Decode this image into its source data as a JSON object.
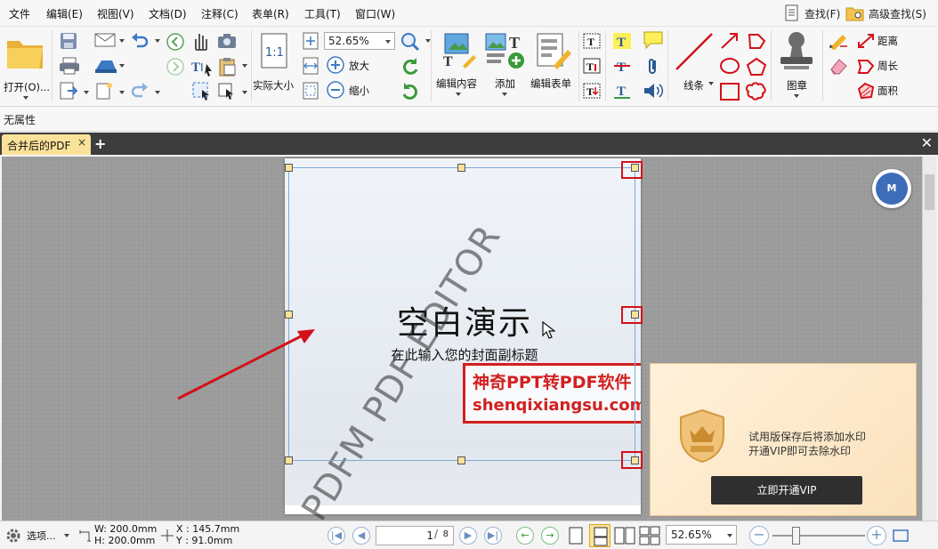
{
  "menu": [
    "文件",
    "编辑(E)",
    "视图(V)",
    "文档(D)",
    "注释(C)",
    "表单(R)",
    "工具(T)",
    "窗口(W)"
  ],
  "search": {
    "find_label": "查找(F)",
    "advanced_label": "高级查找(S)"
  },
  "ribbon": {
    "open_label": "打开(O)...",
    "zoom_value": "52.65%",
    "actual_size_label": "实际大小",
    "zoom_in_label": "放大",
    "zoom_out_label": "缩小",
    "edit_content_label": "编辑内容",
    "add_label": "添加",
    "edit_form_label": "编辑表单",
    "lines_label": "线条",
    "stamp_label": "图章",
    "distance_label": "距离",
    "perimeter_label": "周长",
    "area_label": "面积"
  },
  "properties": {
    "label": "无属性"
  },
  "tabs": [
    {
      "label": "合并后的PDF"
    }
  ],
  "slide": {
    "title": "空白演示",
    "subtitle": "在此输入您的封面副标题",
    "watermark": "PDFM PDF EDITOR",
    "stamp_line1": "神奇PPT转PDF软件",
    "stamp_line2": "shenqixiangsu.com"
  },
  "vip": {
    "line1": "试用版保存后将添加水印",
    "line2": "开通VIP即可去除水印",
    "button": "立即开通VIP"
  },
  "status": {
    "options_label": "选项...",
    "width": "W: 200.0mm",
    "height": "H: 200.0mm",
    "x": "X : 145.7mm",
    "y": "Y :   91.0mm",
    "page_current": "1",
    "page_total": "8",
    "zoom_value": "52.65%"
  },
  "colors": {
    "accent_red": "#d4101a",
    "tab_active": "#fbe29a",
    "fab_blue": "#3d6cb9"
  }
}
